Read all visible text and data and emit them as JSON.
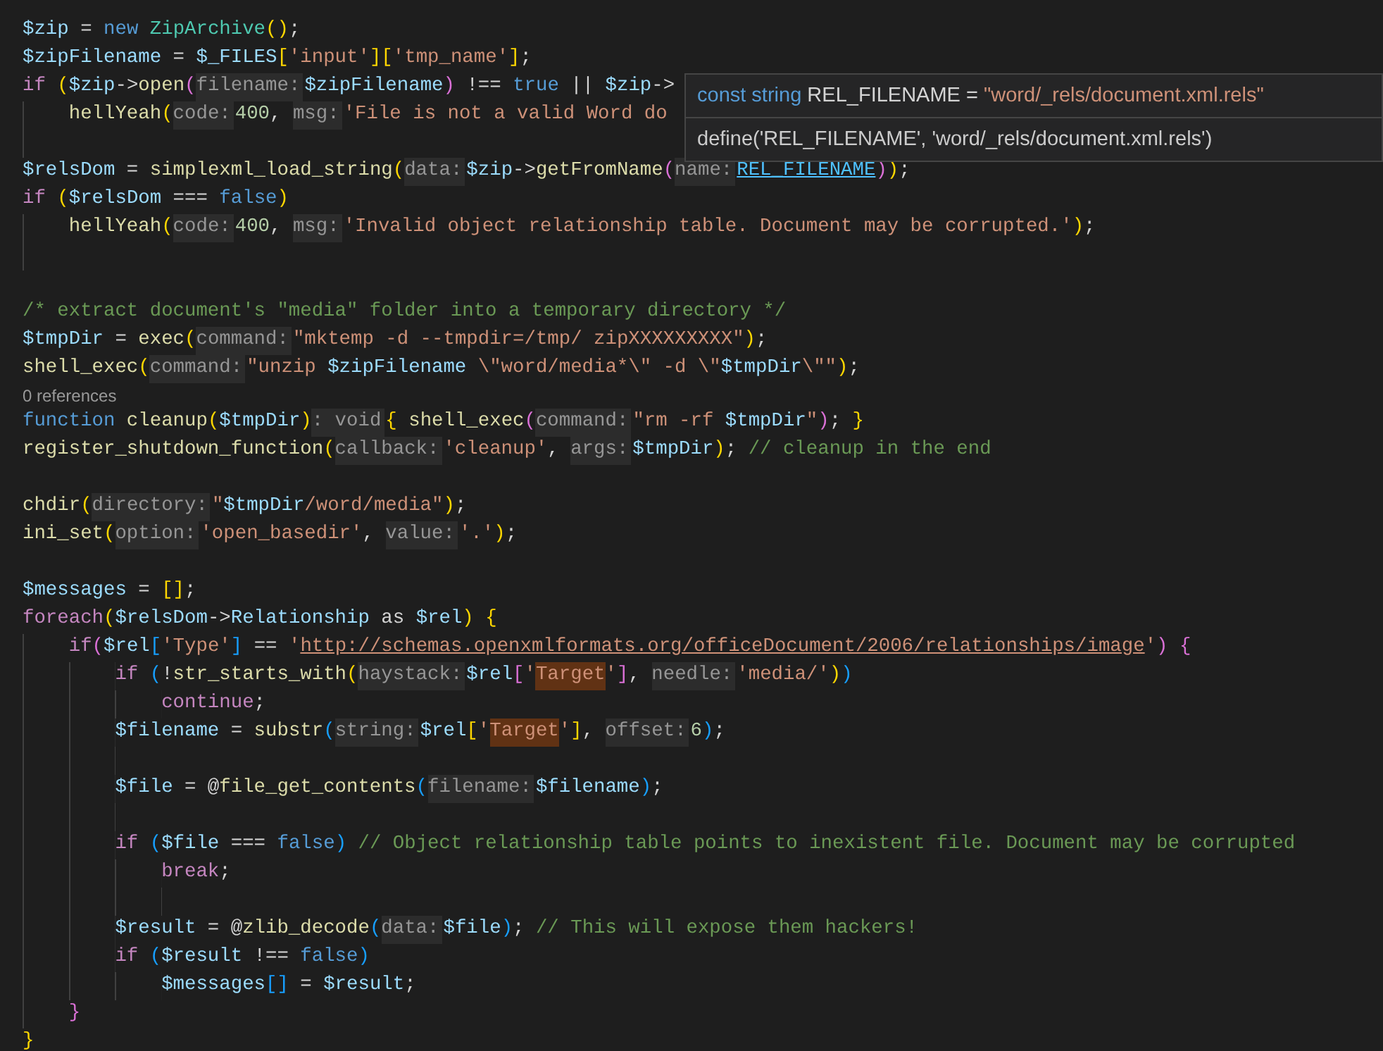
{
  "editor": {
    "lines": [
      {
        "kind": "code",
        "tokens": [
          {
            "kind": "var",
            "text": "$zip"
          },
          {
            "kind": "op",
            "text": " = "
          },
          {
            "kind": "kw",
            "text": "new"
          },
          {
            "kind": "cls",
            "text": " ZipArchive"
          },
          {
            "kind": "b1",
            "text": "()"
          },
          {
            "kind": "op",
            "text": ";"
          }
        ]
      },
      {
        "kind": "code",
        "tokens": [
          {
            "kind": "var",
            "text": "$zipFilename"
          },
          {
            "kind": "op",
            "text": " = "
          },
          {
            "kind": "var",
            "text": "$_FILES"
          },
          {
            "kind": "b1",
            "text": "["
          },
          {
            "kind": "str",
            "text": "'input'"
          },
          {
            "kind": "b1",
            "text": "]["
          },
          {
            "kind": "str",
            "text": "'tmp_name'"
          },
          {
            "kind": "b1",
            "text": "]"
          },
          {
            "kind": "op",
            "text": ";"
          }
        ]
      },
      {
        "kind": "code",
        "tokens": [
          {
            "kind": "ctrl",
            "text": "if"
          },
          {
            "kind": "b1",
            "text": " ("
          },
          {
            "kind": "var",
            "text": "$zip"
          },
          {
            "kind": "op",
            "text": "->"
          },
          {
            "kind": "fn",
            "text": "open"
          },
          {
            "kind": "b2",
            "text": "("
          },
          {
            "kind": "hint",
            "text": "filename:"
          },
          {
            "kind": "var",
            "text": "$zipFilename"
          },
          {
            "kind": "b2",
            "text": ")"
          },
          {
            "kind": "op",
            "text": " !== "
          },
          {
            "kind": "kw",
            "text": "true"
          },
          {
            "kind": "op",
            "text": " || "
          },
          {
            "kind": "var",
            "text": "$zip"
          },
          {
            "kind": "op",
            "text": "->"
          }
        ]
      },
      {
        "kind": "code",
        "tokens": [
          {
            "kind": "fn",
            "text": "    hellYeah"
          },
          {
            "kind": "b1",
            "text": "("
          },
          {
            "kind": "hint",
            "text": "code:"
          },
          {
            "kind": "num",
            "text": "400"
          },
          {
            "kind": "op",
            "text": ", "
          },
          {
            "kind": "hint",
            "text": "msg:"
          },
          {
            "kind": "str",
            "text": "'File is not a valid Word do"
          }
        ]
      },
      {
        "kind": "blank"
      },
      {
        "kind": "code",
        "tokens": [
          {
            "kind": "var",
            "text": "$relsDom"
          },
          {
            "kind": "op",
            "text": " = "
          },
          {
            "kind": "fn",
            "text": "simplexml_load_string"
          },
          {
            "kind": "b1",
            "text": "("
          },
          {
            "kind": "hint",
            "text": "data:"
          },
          {
            "kind": "var",
            "text": "$zip"
          },
          {
            "kind": "op",
            "text": "->"
          },
          {
            "kind": "fn",
            "text": "getFromName"
          },
          {
            "kind": "b2",
            "text": "("
          },
          {
            "kind": "hint",
            "text": "name:"
          },
          {
            "kind": "link",
            "text": "REL_FILENAME"
          },
          {
            "kind": "b2",
            "text": ")"
          },
          {
            "kind": "b1",
            "text": ")"
          },
          {
            "kind": "op",
            "text": ";"
          }
        ]
      },
      {
        "kind": "code",
        "tokens": [
          {
            "kind": "ctrl",
            "text": "if"
          },
          {
            "kind": "b1",
            "text": " ("
          },
          {
            "kind": "var",
            "text": "$relsDom"
          },
          {
            "kind": "op",
            "text": " === "
          },
          {
            "kind": "kw",
            "text": "false"
          },
          {
            "kind": "b1",
            "text": ")"
          }
        ]
      },
      {
        "kind": "code",
        "tokens": [
          {
            "kind": "fn",
            "text": "    hellYeah"
          },
          {
            "kind": "b1",
            "text": "("
          },
          {
            "kind": "hint",
            "text": "code:"
          },
          {
            "kind": "num",
            "text": "400"
          },
          {
            "kind": "op",
            "text": ", "
          },
          {
            "kind": "hint",
            "text": "msg:"
          },
          {
            "kind": "str",
            "text": "'Invalid object relationship table. Document may be corrupted.'"
          },
          {
            "kind": "b1",
            "text": ")"
          },
          {
            "kind": "op",
            "text": ";"
          }
        ]
      },
      {
        "kind": "blank"
      },
      {
        "kind": "blank"
      },
      {
        "kind": "code",
        "tokens": [
          {
            "kind": "cm",
            "text": "/* extract document's \"media\" folder into a temporary directory */"
          }
        ]
      },
      {
        "kind": "code",
        "tokens": [
          {
            "kind": "var",
            "text": "$tmpDir"
          },
          {
            "kind": "op",
            "text": " = "
          },
          {
            "kind": "fn",
            "text": "exec"
          },
          {
            "kind": "b1",
            "text": "("
          },
          {
            "kind": "hint",
            "text": "command:"
          },
          {
            "kind": "str",
            "text": "\"mktemp -d --tmpdir=/tmp/ zipXXXXXXXXX\""
          },
          {
            "kind": "b1",
            "text": ")"
          },
          {
            "kind": "op",
            "text": ";"
          }
        ]
      },
      {
        "kind": "code",
        "tokens": [
          {
            "kind": "fn",
            "text": "shell_exec"
          },
          {
            "kind": "b1",
            "text": "("
          },
          {
            "kind": "hint",
            "text": "command:"
          },
          {
            "kind": "str",
            "text": "\"unzip "
          },
          {
            "kind": "var",
            "text": "$zipFilename"
          },
          {
            "kind": "str",
            "text": " \\\"word/media*\\\" -d \\\""
          },
          {
            "kind": "var",
            "text": "$tmpDir"
          },
          {
            "kind": "str",
            "text": "\\\"\""
          },
          {
            "kind": "b1",
            "text": ")"
          },
          {
            "kind": "op",
            "text": ";"
          }
        ]
      },
      {
        "kind": "codelens",
        "text": "0 references"
      },
      {
        "kind": "code",
        "tokens": [
          {
            "kind": "kw",
            "text": "function"
          },
          {
            "kind": "fn",
            "text": " cleanup"
          },
          {
            "kind": "b1",
            "text": "("
          },
          {
            "kind": "var",
            "text": "$tmpDir"
          },
          {
            "kind": "b1",
            "text": ")"
          },
          {
            "kind": "hint",
            "text": ": void"
          },
          {
            "kind": "b1",
            "text": "{"
          },
          {
            "kind": "fn",
            "text": " shell_exec"
          },
          {
            "kind": "b2",
            "text": "("
          },
          {
            "kind": "hint",
            "text": "command:"
          },
          {
            "kind": "str",
            "text": "\"rm -rf "
          },
          {
            "kind": "var",
            "text": "$tmpDir"
          },
          {
            "kind": "str",
            "text": "\""
          },
          {
            "kind": "b2",
            "text": ")"
          },
          {
            "kind": "op",
            "text": ";"
          },
          {
            "kind": "b1",
            "text": " }"
          }
        ]
      },
      {
        "kind": "code",
        "tokens": [
          {
            "kind": "fn",
            "text": "register_shutdown_function"
          },
          {
            "kind": "b1",
            "text": "("
          },
          {
            "kind": "hint",
            "text": "callback:"
          },
          {
            "kind": "str",
            "text": "'cleanup'"
          },
          {
            "kind": "op",
            "text": ", "
          },
          {
            "kind": "hint",
            "text": "args:"
          },
          {
            "kind": "var",
            "text": "$tmpDir"
          },
          {
            "kind": "b1",
            "text": ")"
          },
          {
            "kind": "op",
            "text": ";"
          },
          {
            "kind": "cm",
            "text": " // cleanup in the end"
          }
        ]
      },
      {
        "kind": "blank"
      },
      {
        "kind": "code",
        "tokens": [
          {
            "kind": "fn",
            "text": "chdir"
          },
          {
            "kind": "b1",
            "text": "("
          },
          {
            "kind": "hint",
            "text": "directory:"
          },
          {
            "kind": "str",
            "text": "\""
          },
          {
            "kind": "var",
            "text": "$tmpDir"
          },
          {
            "kind": "str",
            "text": "/word/media\""
          },
          {
            "kind": "b1",
            "text": ")"
          },
          {
            "kind": "op",
            "text": ";"
          }
        ]
      },
      {
        "kind": "code",
        "tokens": [
          {
            "kind": "fn",
            "text": "ini_set"
          },
          {
            "kind": "b1",
            "text": "("
          },
          {
            "kind": "hint",
            "text": "option:"
          },
          {
            "kind": "str",
            "text": "'open_basedir'"
          },
          {
            "kind": "op",
            "text": ", "
          },
          {
            "kind": "hint",
            "text": "value:"
          },
          {
            "kind": "str",
            "text": "'.'"
          },
          {
            "kind": "b1",
            "text": ")"
          },
          {
            "kind": "op",
            "text": ";"
          }
        ]
      },
      {
        "kind": "blank"
      },
      {
        "kind": "code",
        "tokens": [
          {
            "kind": "var",
            "text": "$messages"
          },
          {
            "kind": "op",
            "text": " = "
          },
          {
            "kind": "b1",
            "text": "[]"
          },
          {
            "kind": "op",
            "text": ";"
          }
        ]
      },
      {
        "kind": "code",
        "tokens": [
          {
            "kind": "ctrl",
            "text": "foreach"
          },
          {
            "kind": "b1",
            "text": "("
          },
          {
            "kind": "var",
            "text": "$relsDom"
          },
          {
            "kind": "op",
            "text": "->"
          },
          {
            "kind": "var",
            "text": "Relationship"
          },
          {
            "kind": "op",
            "text": " as "
          },
          {
            "kind": "var",
            "text": "$rel"
          },
          {
            "kind": "b1",
            "text": ")"
          },
          {
            "kind": "b1",
            "text": " {"
          }
        ]
      },
      {
        "kind": "code",
        "tokens": [
          {
            "kind": "ctrl",
            "text": "    if"
          },
          {
            "kind": "b2",
            "text": "("
          },
          {
            "kind": "var",
            "text": "$rel"
          },
          {
            "kind": "b3",
            "text": "["
          },
          {
            "kind": "str",
            "text": "'Type'"
          },
          {
            "kind": "b3",
            "text": "]"
          },
          {
            "kind": "op",
            "text": " == "
          },
          {
            "kind": "str",
            "text": "'"
          },
          {
            "kind": "url",
            "text": "http://schemas.openxmlformats.org/officeDocument/2006/relationships/image"
          },
          {
            "kind": "str",
            "text": "'"
          },
          {
            "kind": "b2",
            "text": ")"
          },
          {
            "kind": "b2",
            "text": " {"
          }
        ]
      },
      {
        "kind": "code",
        "tokens": [
          {
            "kind": "ctrl",
            "text": "        if"
          },
          {
            "kind": "b3",
            "text": " ("
          },
          {
            "kind": "op",
            "text": "!"
          },
          {
            "kind": "fn",
            "text": "str_starts_with"
          },
          {
            "kind": "b1",
            "text": "("
          },
          {
            "kind": "hint",
            "text": "haystack:"
          },
          {
            "kind": "var",
            "text": "$rel"
          },
          {
            "kind": "b2",
            "text": "["
          },
          {
            "kind": "str",
            "text": "'"
          },
          {
            "kind": "match",
            "text": "Target"
          },
          {
            "kind": "str",
            "text": "'"
          },
          {
            "kind": "b2",
            "text": "]"
          },
          {
            "kind": "op",
            "text": ", "
          },
          {
            "kind": "hint",
            "text": "needle:"
          },
          {
            "kind": "str",
            "text": "'media/'"
          },
          {
            "kind": "b1",
            "text": ")"
          },
          {
            "kind": "b3",
            "text": ")"
          }
        ]
      },
      {
        "kind": "code",
        "tokens": [
          {
            "kind": "ctrl",
            "text": "            continue"
          },
          {
            "kind": "op",
            "text": ";"
          }
        ]
      },
      {
        "kind": "code",
        "tokens": [
          {
            "kind": "var",
            "text": "        $filename"
          },
          {
            "kind": "op",
            "text": " = "
          },
          {
            "kind": "fn",
            "text": "substr"
          },
          {
            "kind": "b3",
            "text": "("
          },
          {
            "kind": "hint",
            "text": "string:"
          },
          {
            "kind": "var",
            "text": "$rel"
          },
          {
            "kind": "b1",
            "text": "["
          },
          {
            "kind": "str",
            "text": "'"
          },
          {
            "kind": "match",
            "text": "Target"
          },
          {
            "kind": "str",
            "text": "'"
          },
          {
            "kind": "b1",
            "text": "]"
          },
          {
            "kind": "op",
            "text": ", "
          },
          {
            "kind": "hint",
            "text": "offset:"
          },
          {
            "kind": "num",
            "text": "6"
          },
          {
            "kind": "b3",
            "text": ")"
          },
          {
            "kind": "op",
            "text": ";"
          }
        ]
      },
      {
        "kind": "blank"
      },
      {
        "kind": "code",
        "tokens": [
          {
            "kind": "var",
            "text": "        $file"
          },
          {
            "kind": "op",
            "text": " = @"
          },
          {
            "kind": "fn",
            "text": "file_get_contents"
          },
          {
            "kind": "b3",
            "text": "("
          },
          {
            "kind": "hint",
            "text": "filename:"
          },
          {
            "kind": "var",
            "text": "$filename"
          },
          {
            "kind": "b3",
            "text": ")"
          },
          {
            "kind": "op",
            "text": ";"
          }
        ]
      },
      {
        "kind": "blank"
      },
      {
        "kind": "code",
        "tokens": [
          {
            "kind": "ctrl",
            "text": "        if"
          },
          {
            "kind": "b3",
            "text": " ("
          },
          {
            "kind": "var",
            "text": "$file"
          },
          {
            "kind": "op",
            "text": " === "
          },
          {
            "kind": "kw",
            "text": "false"
          },
          {
            "kind": "b3",
            "text": ")"
          },
          {
            "kind": "cm",
            "text": " // Object relationship table points to inexistent file. Document may be corrupted"
          }
        ]
      },
      {
        "kind": "code",
        "tokens": [
          {
            "kind": "ctrl",
            "text": "            break"
          },
          {
            "kind": "op",
            "text": ";"
          }
        ]
      },
      {
        "kind": "blank"
      },
      {
        "kind": "code",
        "tokens": [
          {
            "kind": "var",
            "text": "        $result"
          },
          {
            "kind": "op",
            "text": " = @"
          },
          {
            "kind": "fn",
            "text": "zlib_decode"
          },
          {
            "kind": "b3",
            "text": "("
          },
          {
            "kind": "hint",
            "text": "data:"
          },
          {
            "kind": "var",
            "text": "$file"
          },
          {
            "kind": "b3",
            "text": ")"
          },
          {
            "kind": "op",
            "text": ";"
          },
          {
            "kind": "cm",
            "text": " // This will expose them hackers!"
          }
        ]
      },
      {
        "kind": "code",
        "tokens": [
          {
            "kind": "ctrl",
            "text": "        if"
          },
          {
            "kind": "b3",
            "text": " ("
          },
          {
            "kind": "var",
            "text": "$result"
          },
          {
            "kind": "op",
            "text": " !== "
          },
          {
            "kind": "kw",
            "text": "false"
          },
          {
            "kind": "b3",
            "text": ")"
          }
        ]
      },
      {
        "kind": "code",
        "tokens": [
          {
            "kind": "var",
            "text": "            $messages"
          },
          {
            "kind": "b3",
            "text": "[]"
          },
          {
            "kind": "op",
            "text": " = "
          },
          {
            "kind": "var",
            "text": "$result"
          },
          {
            "kind": "op",
            "text": ";"
          }
        ]
      },
      {
        "kind": "code",
        "tokens": [
          {
            "kind": "b2",
            "text": "    }"
          }
        ]
      },
      {
        "kind": "code",
        "tokens": [
          {
            "kind": "b1",
            "text": "}"
          }
        ]
      }
    ]
  },
  "hover": {
    "signature": [
      {
        "kind": "kw",
        "text": "const string"
      },
      {
        "kind": "op",
        "text": " REL_FILENAME = "
      },
      {
        "kind": "str",
        "text": "\"word/_rels/document.xml.rels\""
      }
    ],
    "definition": "define('REL_FILENAME', 'word/_rels/document.xml.rels')"
  }
}
